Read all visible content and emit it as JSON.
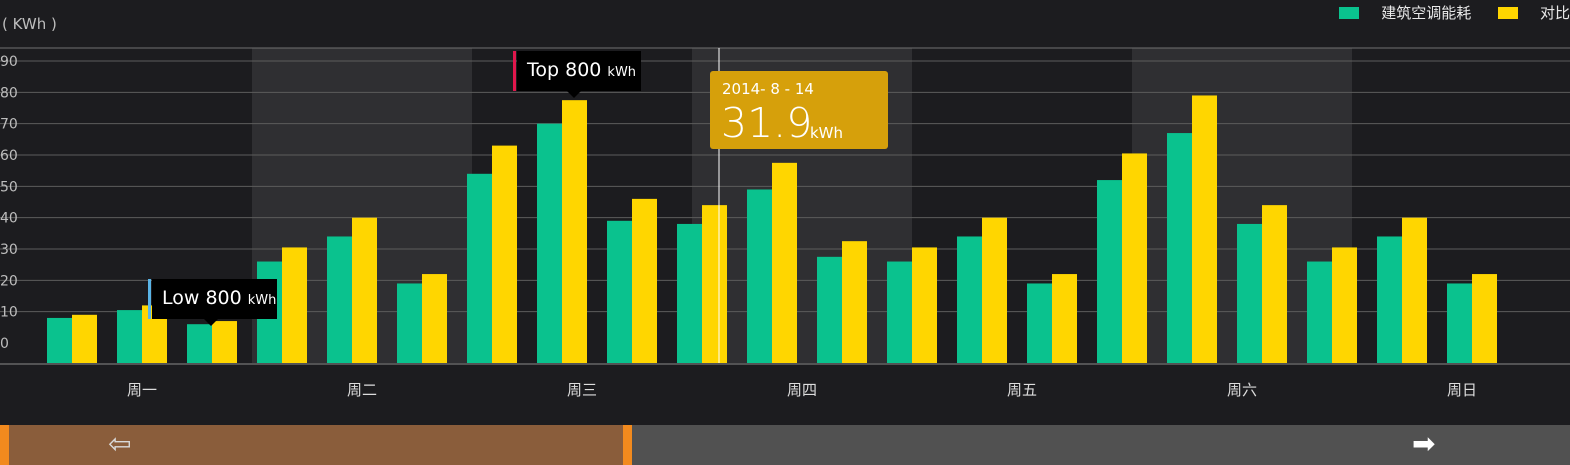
{
  "unit_label": "( KWh )",
  "legend": [
    {
      "name": "建筑空调能耗",
      "color": "#0ac28e"
    },
    {
      "name": "对比",
      "color": "#ffd600"
    }
  ],
  "chart_data": {
    "type": "bar",
    "y_ticks": [
      "90",
      "80",
      "70",
      "60",
      "50",
      "40",
      "30",
      "20",
      "10",
      "0"
    ],
    "ylim": [
      0,
      90
    ],
    "days": [
      "周一",
      "周二",
      "周三",
      "周四",
      "周五",
      "周六",
      "周日"
    ],
    "groups_per_day": 3,
    "series": [
      {
        "name": "建筑空调能耗",
        "color": "#0ac28e",
        "values": [
          8,
          10.5,
          6,
          26,
          34,
          19,
          54,
          70,
          39,
          38,
          49,
          27.5,
          26,
          34,
          19,
          52,
          67,
          38,
          26,
          34,
          19
        ]
      },
      {
        "name": "对比",
        "color": "#ffd600",
        "values": [
          9,
          12,
          7,
          30.5,
          40,
          22,
          63,
          77.5,
          46,
          44,
          57.5,
          32.5,
          30.5,
          40,
          22,
          60.5,
          79,
          44,
          30.5,
          40,
          22
        ]
      }
    ],
    "grid": true,
    "shaded_days": [
      "周二",
      "周四",
      "周六"
    ],
    "legend_position": "top-right"
  },
  "tooltip": {
    "date": "2014- 8 - 14",
    "value": "31.9",
    "unit": "kWh"
  },
  "markers": {
    "top": {
      "label": "Top 800",
      "unit": "kWh",
      "color": "#e0174c"
    },
    "low": {
      "label": "Low 800",
      "unit": "kWh",
      "color": "#5ab4e6"
    }
  },
  "nav": {
    "left_arrow": "⇦",
    "right_arrow": "➡"
  }
}
